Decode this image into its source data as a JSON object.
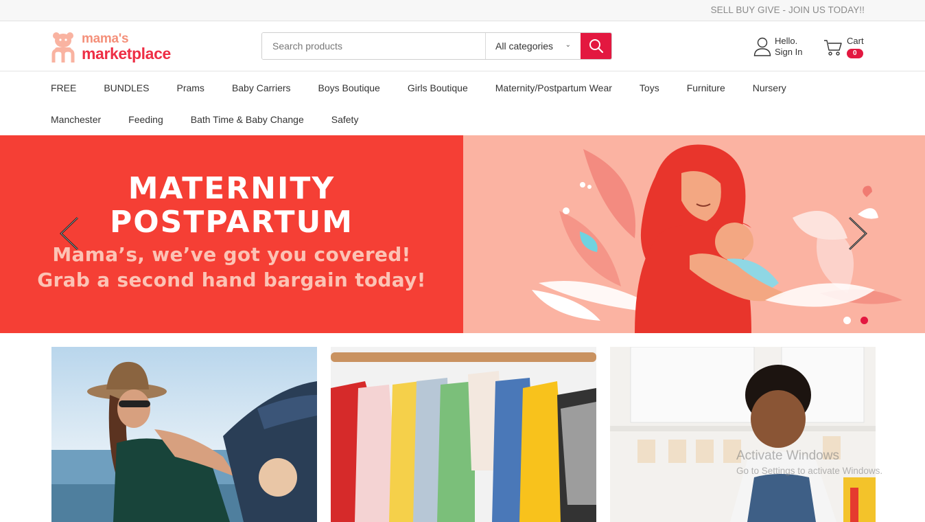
{
  "topbar": {
    "text": "SELL BUY GIVE - JOIN US TODAY!!"
  },
  "logo": {
    "line1": "mama's",
    "line2": "marketplace"
  },
  "search": {
    "placeholder": "Search products",
    "category": "All categories"
  },
  "account": {
    "hello": "Hello.",
    "signin": "Sign In"
  },
  "cart": {
    "label": "Cart",
    "count": "0"
  },
  "nav": {
    "row1": [
      "FREE",
      "BUNDLES",
      "Prams",
      "Baby Carriers",
      "Boys Boutique",
      "Girls Boutique",
      "Maternity/Postpartum Wear",
      "Toys",
      "Furniture",
      "Nursery"
    ],
    "row2": [
      "Manchester",
      "Feeding",
      "Bath Time & Baby Change",
      "Safety"
    ]
  },
  "hero": {
    "title1": "MATERNITY",
    "title2": "POSTPARTUM",
    "sub1": "Mama’s, we’ve got you covered!",
    "sub2": "Grab a second hand bargain today!",
    "active_slide": 2,
    "slide_count": 2
  },
  "colors": {
    "brand_red": "#e31840",
    "hero_red": "#f53f35",
    "hero_pink": "#fbb3a2",
    "logo_peach": "#f4907a"
  },
  "watermark": {
    "line1": "Activate Windows",
    "line2": "Go to Settings to activate Windows."
  }
}
